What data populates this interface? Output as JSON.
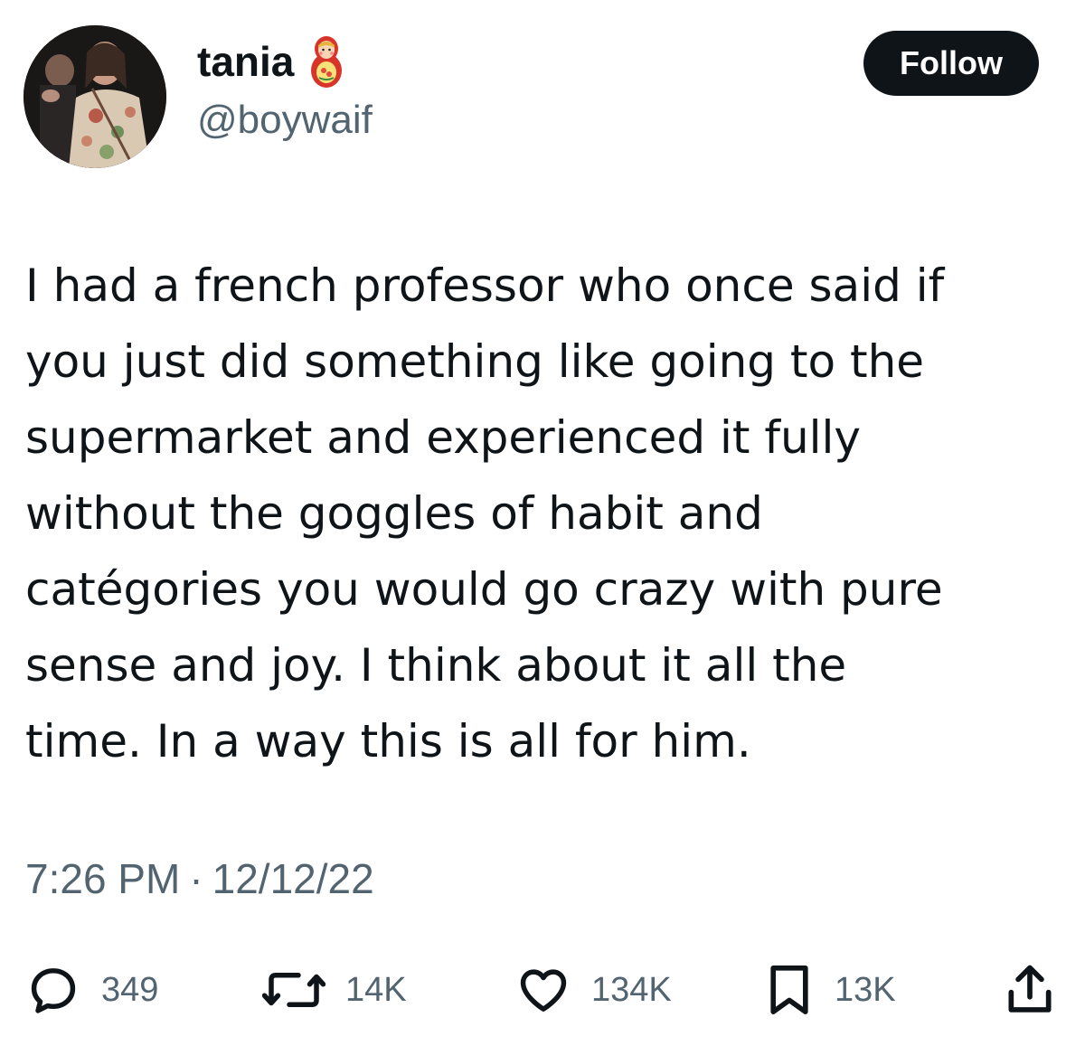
{
  "author": {
    "display_name": "tania",
    "name_emoji": "nesting-doll-icon",
    "handle": "@boywaif",
    "avatar": "profile-photo"
  },
  "follow_label": "Follow",
  "tweet": {
    "lines": [
      "I had a french professor who once said if",
      "you just did something like going to the",
      "supermarket and experienced it fully",
      "without the goggles of habit and",
      "catégories you would go crazy with pure",
      "sense and joy. I think about it all the",
      "time. In a way this is all for him."
    ],
    "time": "7:26 PM",
    "separator": "·",
    "date": "12/12/22"
  },
  "actions": {
    "replies": "349",
    "retweets": "14K",
    "likes": "134K",
    "bookmarks": "13K"
  },
  "colors": {
    "text_primary": "#0f1419",
    "text_secondary": "#536471",
    "button_bg": "#0f1419",
    "button_text": "#ffffff"
  }
}
